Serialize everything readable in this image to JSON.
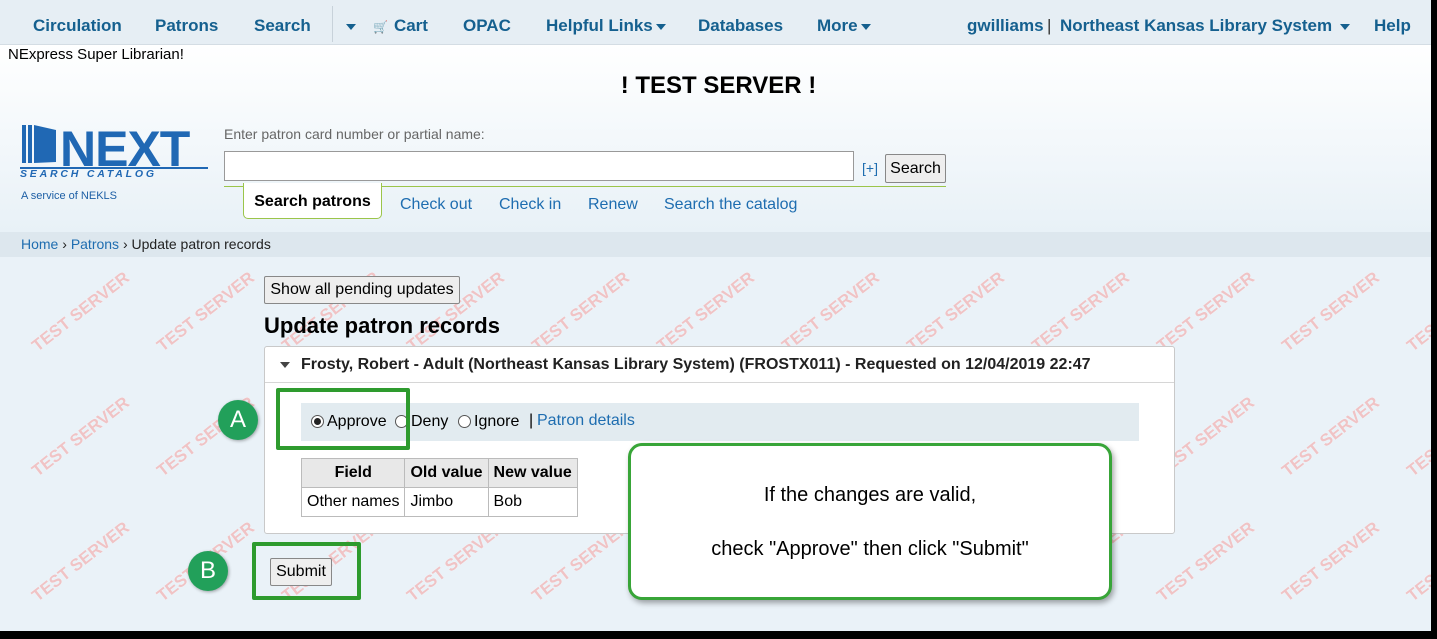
{
  "topnav": {
    "items": [
      "Circulation",
      "Patrons",
      "Search"
    ],
    "cart": "Cart",
    "items2": [
      "OPAC",
      "Helpful Links",
      "Databases",
      "More"
    ],
    "user": "gwilliams",
    "separator": "|",
    "library": "Northeast Kansas Library System",
    "help": "Help"
  },
  "header": {
    "login_text": "NExpress Super Librarian!",
    "test_server": "! TEST SERVER !",
    "logo_text": "NEXT",
    "logo_subtitle": "SEARCH CATALOG",
    "logo_service": "A service of NEKLS"
  },
  "search": {
    "label": "Enter patron card number or partial name:",
    "value": "",
    "plus": "[+]",
    "button": "Search"
  },
  "tabs": {
    "active": "Search patrons",
    "links": [
      "Check out",
      "Check in",
      "Renew",
      "Search the catalog"
    ]
  },
  "breadcrumb": {
    "home": "Home",
    "patrons": "Patrons",
    "current": "Update patron records",
    "sep": "›"
  },
  "main": {
    "pending_button": "Show all pending updates",
    "title": "Update patron records",
    "panel_title": "Frosty, Robert - Adult (Northeast Kansas Library System) (FROSTX011) - Requested on 12/04/2019 22:47",
    "actions": {
      "approve": "Approve",
      "deny": "Deny",
      "ignore": "Ignore",
      "selected": "Approve",
      "sep": "|",
      "patron_details": "Patron details"
    },
    "table": {
      "headers": [
        "Field",
        "Old value",
        "New value"
      ],
      "rows": [
        [
          "Other names",
          "Jimbo",
          "Bob"
        ]
      ]
    },
    "submit": "Submit"
  },
  "annotations": {
    "marker_a": "A",
    "marker_b": "B",
    "tip_line1": "If the changes are valid,",
    "tip_line2": "check \"Approve\" then click \"Submit\""
  },
  "watermark_text": "TEST SERVER",
  "colors": {
    "link": "#1e6db0",
    "nav": "#15608f",
    "callout_green": "#2e9b2e",
    "marker_green": "#22a05a",
    "watermark": "#f2b4b4"
  }
}
